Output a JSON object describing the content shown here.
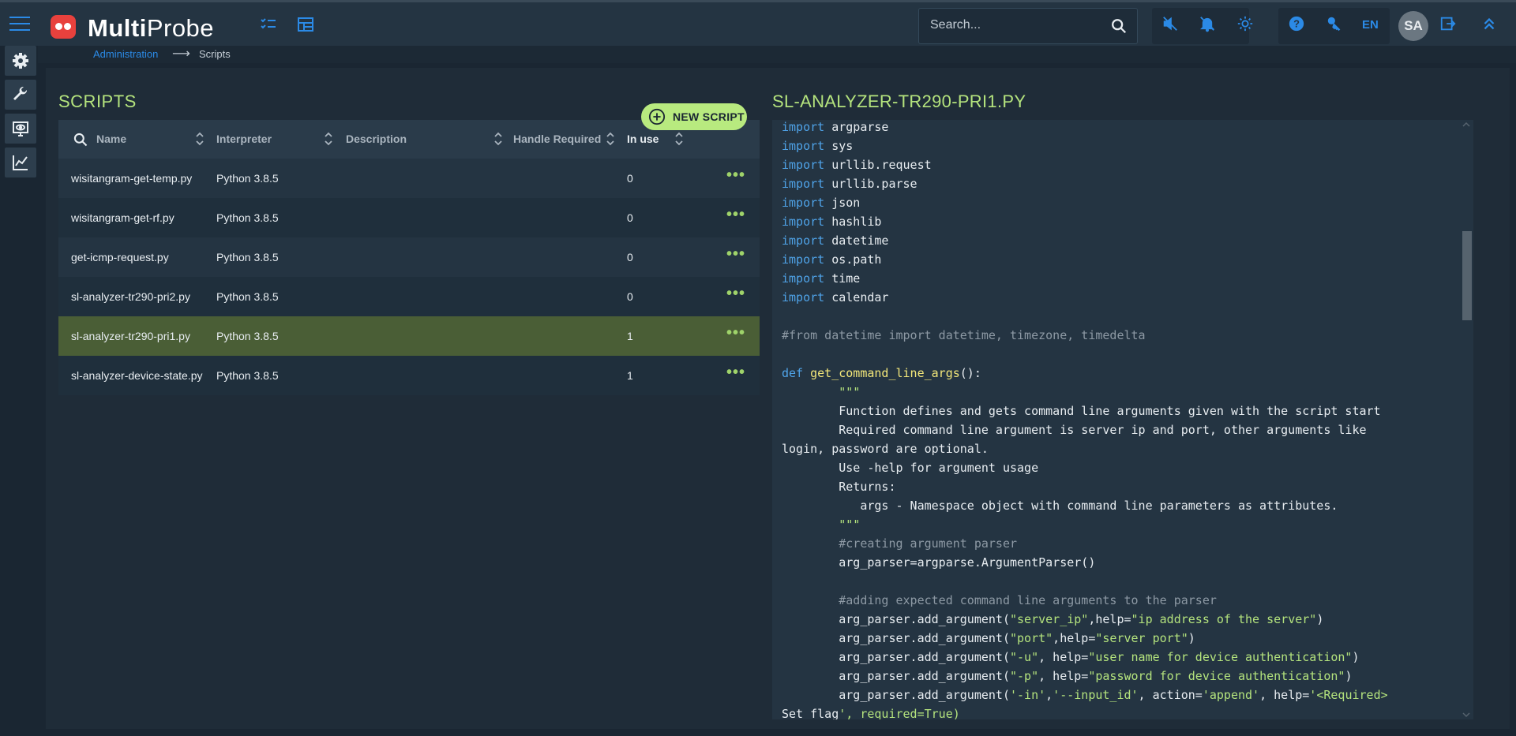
{
  "app": {
    "brand_bold": "Multi",
    "brand_light": "Probe"
  },
  "search": {
    "placeholder": "Search..."
  },
  "header": {
    "lang": "EN",
    "avatar": "SA"
  },
  "breadcrumb": {
    "parent": "Administration",
    "current": "Scripts"
  },
  "scripts": {
    "title": "SCRIPTS",
    "new_button": "NEW SCRIPT",
    "columns": [
      "Name",
      "Interpreter",
      "Description",
      "Handle Required",
      "In use"
    ],
    "rows": [
      {
        "name": "wisitangram-get-temp.py",
        "interpreter": "Python 3.8.5",
        "description": "",
        "handle_required": "",
        "in_use": "0"
      },
      {
        "name": "wisitangram-get-rf.py",
        "interpreter": "Python 3.8.5",
        "description": "",
        "handle_required": "",
        "in_use": "0"
      },
      {
        "name": "get-icmp-request.py",
        "interpreter": "Python 3.8.5",
        "description": "",
        "handle_required": "",
        "in_use": "0"
      },
      {
        "name": "sl-analyzer-tr290-pri2.py",
        "interpreter": "Python 3.8.5",
        "description": "",
        "handle_required": "",
        "in_use": "0"
      },
      {
        "name": "sl-analyzer-tr290-pri1.py",
        "interpreter": "Python 3.8.5",
        "description": "",
        "handle_required": "",
        "in_use": "1",
        "selected": true
      },
      {
        "name": "sl-analyzer-device-state.py",
        "interpreter": "Python 3.8.5",
        "description": "",
        "handle_required": "",
        "in_use": "1"
      }
    ],
    "row_menu": "•••"
  },
  "editor": {
    "title": "SL-ANALYZER-TR290-PRI1.PY",
    "lines": [
      "import argparse",
      "import sys",
      "import urllib.request",
      "import urllib.parse",
      "import json",
      "import hashlib",
      "import datetime",
      "import os.path",
      "import time",
      "import calendar",
      "",
      "#from datetime import datetime, timezone, timedelta",
      "",
      "def get_command_line_args():",
      "        \"\"\"",
      "        Function defines and gets command line arguments given with the script start",
      "        Required command line argument is server ip and port, other arguments like",
      "login, password are optional.",
      "        Use -help for argument usage",
      "        Returns:",
      "           args - Namespace object with command line parameters as attributes.",
      "        \"\"\"",
      "        #creating argument parser",
      "        arg_parser=argparse.ArgumentParser()",
      "",
      "        #adding expected command line arguments to the parser",
      "        arg_parser.add_argument(\"server_ip\",help=\"ip address of the server\")",
      "        arg_parser.add_argument(\"port\",help=\"server port\")",
      "        arg_parser.add_argument(\"-u\", help=\"user name for device authentication\")",
      "        arg_parser.add_argument(\"-p\", help=\"password for device authentication\")",
      "        arg_parser.add_argument('-in','--input_id', action='append', help='<Required>",
      "Set flag', required=True)"
    ]
  },
  "colors": {
    "accent": "#b4e37d",
    "link": "#2b8ae6",
    "brand": "#e8413d"
  }
}
